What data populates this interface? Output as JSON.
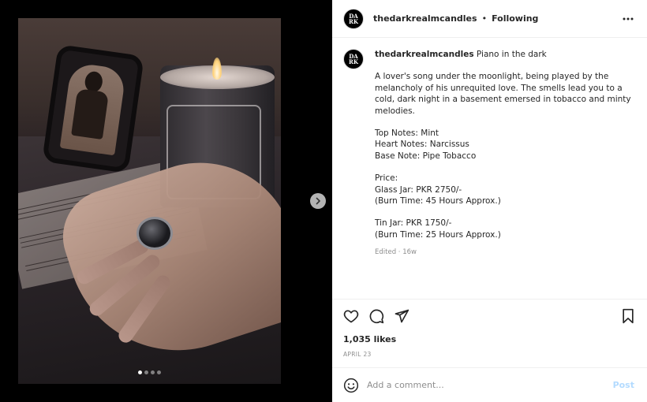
{
  "post": {
    "username": "thedarkrealmcandles",
    "separator": "•",
    "follow_status": "Following",
    "avatar_text": "DA RK",
    "caption_title": "Piano in the dark",
    "caption_paragraphs": [
      "A lover's song under the moonlight, being played by the melancholy of his unrequited love. The smells lead you to a cold, dark night in a basement emersed in tobacco and minty melodies.",
      "Top Notes: Mint\nHeart Notes: Narcissus\nBase Note: Pipe Tobacco",
      "Price:\nGlass Jar: PKR 2750/-\n(Burn Time: 45 Hours Approx.)",
      "Tin Jar: PKR 1750/-\n(Burn Time: 25 Hours Approx.)"
    ],
    "edited": "Edited · 16w",
    "likes": "1,035 likes",
    "date": "APRIL 23"
  },
  "carousel": {
    "total_slides": 4,
    "active_slide": 1
  },
  "comment_box": {
    "placeholder": "Add a comment...",
    "post_label": "Post"
  },
  "icons": {
    "more": "more-horizontal-icon",
    "next": "chevron-right-icon",
    "like": "heart-icon",
    "comment": "comment-icon",
    "share": "send-icon",
    "save": "bookmark-icon",
    "emoji": "emoji-icon"
  },
  "colors": {
    "text": "#262626",
    "muted": "#8e8e8e",
    "post_disabled": "#b3dbff",
    "border": "#efefef"
  }
}
